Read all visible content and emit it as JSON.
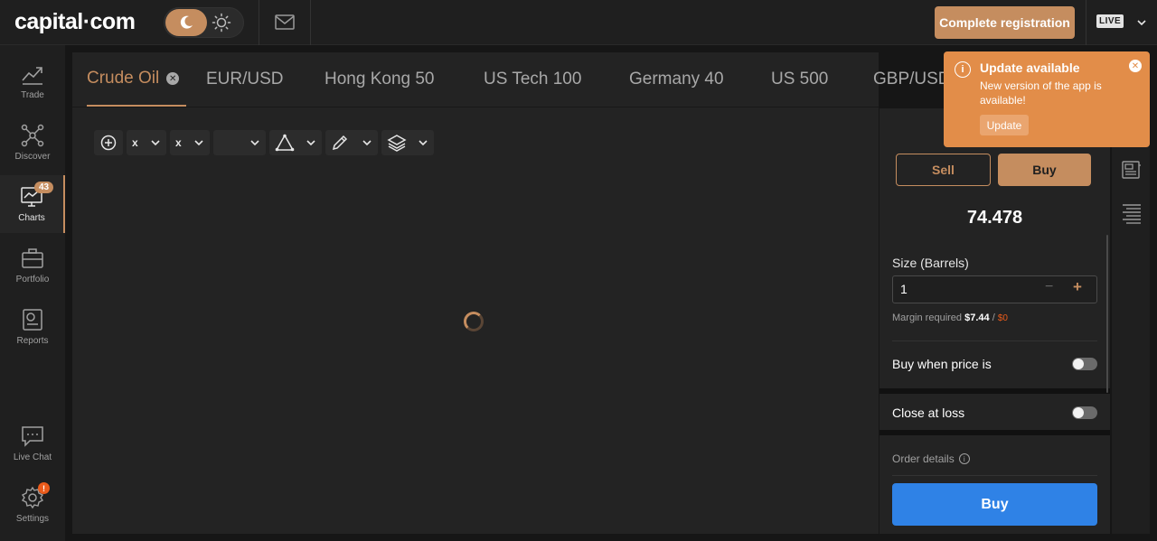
{
  "header": {
    "logo": "capital·com",
    "register_label": "Complete registration",
    "live_label": "LIVE"
  },
  "sidebar": {
    "items": [
      {
        "label": "Trade"
      },
      {
        "label": "Discover"
      },
      {
        "label": "Charts",
        "badge": "43"
      },
      {
        "label": "Portfolio"
      },
      {
        "label": "Reports"
      },
      {
        "label": "Live Chat"
      },
      {
        "label": "Settings",
        "alert": "!"
      }
    ]
  },
  "tabs": [
    {
      "label": "Crude Oil"
    },
    {
      "label": "EUR/USD"
    },
    {
      "label": "Hong Kong 50"
    },
    {
      "label": "US Tech 100"
    },
    {
      "label": "Germany 40"
    },
    {
      "label": "US 500"
    },
    {
      "label": "GBP/USD"
    }
  ],
  "toolbar": {
    "compare_value_1": "x",
    "compare_value_2": "x"
  },
  "trade_panel": {
    "sell_label": "Sell",
    "buy_label": "Buy",
    "price": "74.478",
    "size_label": "Size (Barrels)",
    "size_value": "1",
    "margin_label": "Margin required",
    "margin_value": "$7.44",
    "margin_sep": "/",
    "margin_available": "$0",
    "buy_when_label": "Buy when price is",
    "close_at_loss_label": "Close at loss",
    "order_details_label": "Order details",
    "submit_label": "Buy"
  },
  "popup": {
    "title": "Update available",
    "text": "New version of the app is available!",
    "button_label": "Update"
  },
  "colors": {
    "accent": "#c58d5f",
    "popup": "#e28d49",
    "primary_button": "#2f82e6",
    "alert": "#ea5b1b"
  }
}
